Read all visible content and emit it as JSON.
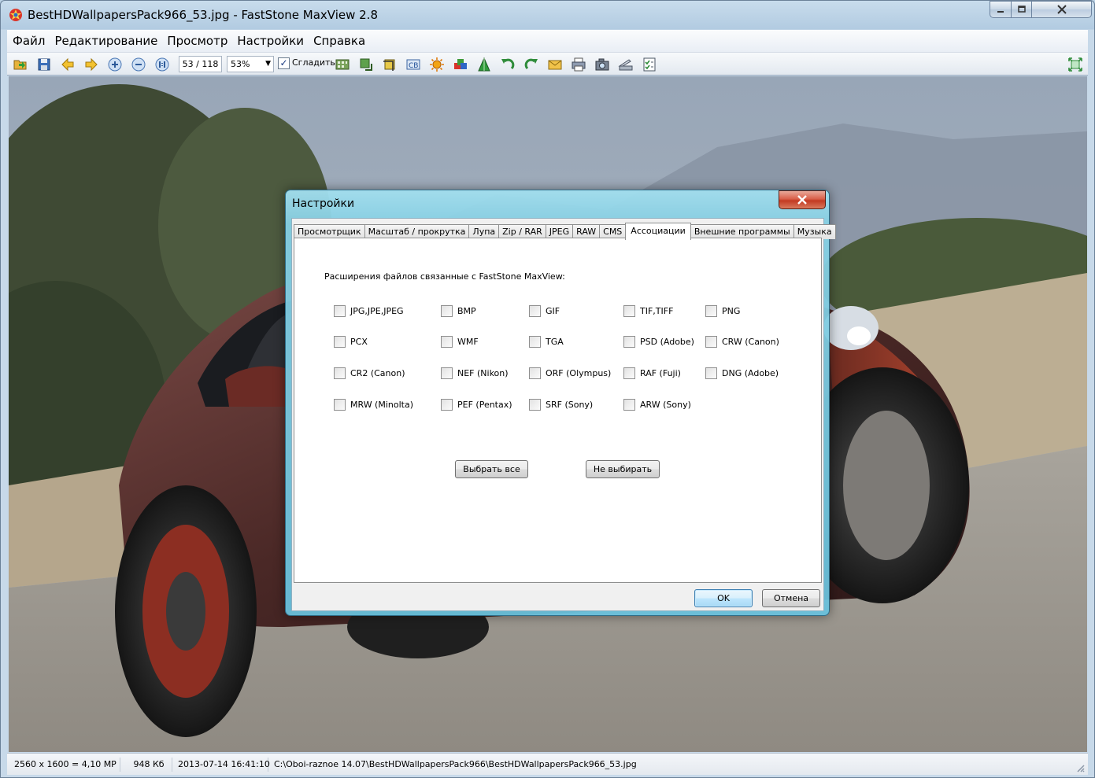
{
  "window": {
    "title": "BestHDWallpapersPack966_53.jpg - FastStone MaxView 2.8",
    "close_glyph": "✕",
    "min_glyph": "▁",
    "max_glyph": "▢"
  },
  "menu": [
    "Файл",
    "Редактирование",
    "Просмотр",
    "Настройки",
    "Справка"
  ],
  "toolbar": {
    "page_counter": "53 / 118",
    "zoom_value": "53%",
    "smooth_checked": true,
    "smooth_label": "Сгладить",
    "check_glyph": "✓",
    "arrow_glyph": "▼"
  },
  "status": {
    "dimensions": "2560 x 1600 = 4,10 MP",
    "file_size": "948 Кб",
    "date": "2013-07-14 16:41:10",
    "path": "C:\\Oboi-raznoe 14.07\\BestHDWallpapersPack966\\BestHDWallpapersPack966_53.jpg"
  },
  "dialog": {
    "title": "Настройки",
    "close_glyph": "✕",
    "tabs": [
      {
        "label": "Просмотрщик",
        "active": false
      },
      {
        "label": "Масштаб / прокрутка",
        "active": false
      },
      {
        "label": "Лупа",
        "active": false
      },
      {
        "label": "Zip / RAR",
        "active": false
      },
      {
        "label": "JPEG",
        "active": false
      },
      {
        "label": "RAW",
        "active": false
      },
      {
        "label": "CMS",
        "active": false
      },
      {
        "label": "Ассоциации",
        "active": true
      },
      {
        "label": "Внешние программы",
        "active": false
      },
      {
        "label": "Музыка",
        "active": false
      }
    ],
    "heading": "Расширения файлов связанные с FastStone MaxView:",
    "associations": [
      [
        "JPG,JPE,JPEG",
        "BMP",
        "GIF",
        "TIF,TIFF",
        "PNG"
      ],
      [
        "PCX",
        "WMF",
        "TGA",
        "PSD (Adobe)",
        "CRW (Canon)"
      ],
      [
        "CR2 (Canon)",
        "NEF (Nikon)",
        "ORF (Olympus)",
        "RAF (Fuji)",
        "DNG (Adobe)"
      ],
      [
        "MRW (Minolta)",
        "PEF (Pentax)",
        "SRF (Sony)",
        "ARW (Sony)"
      ]
    ],
    "select_all_label": "Выбрать все",
    "select_none_label": "Не выбирать",
    "ok_label": "OK",
    "cancel_label": "Отмена"
  },
  "colors": {
    "dialog_glass": "#69c1dc",
    "close_button": "#c33a22",
    "ok_border": "#3c7fb1"
  }
}
